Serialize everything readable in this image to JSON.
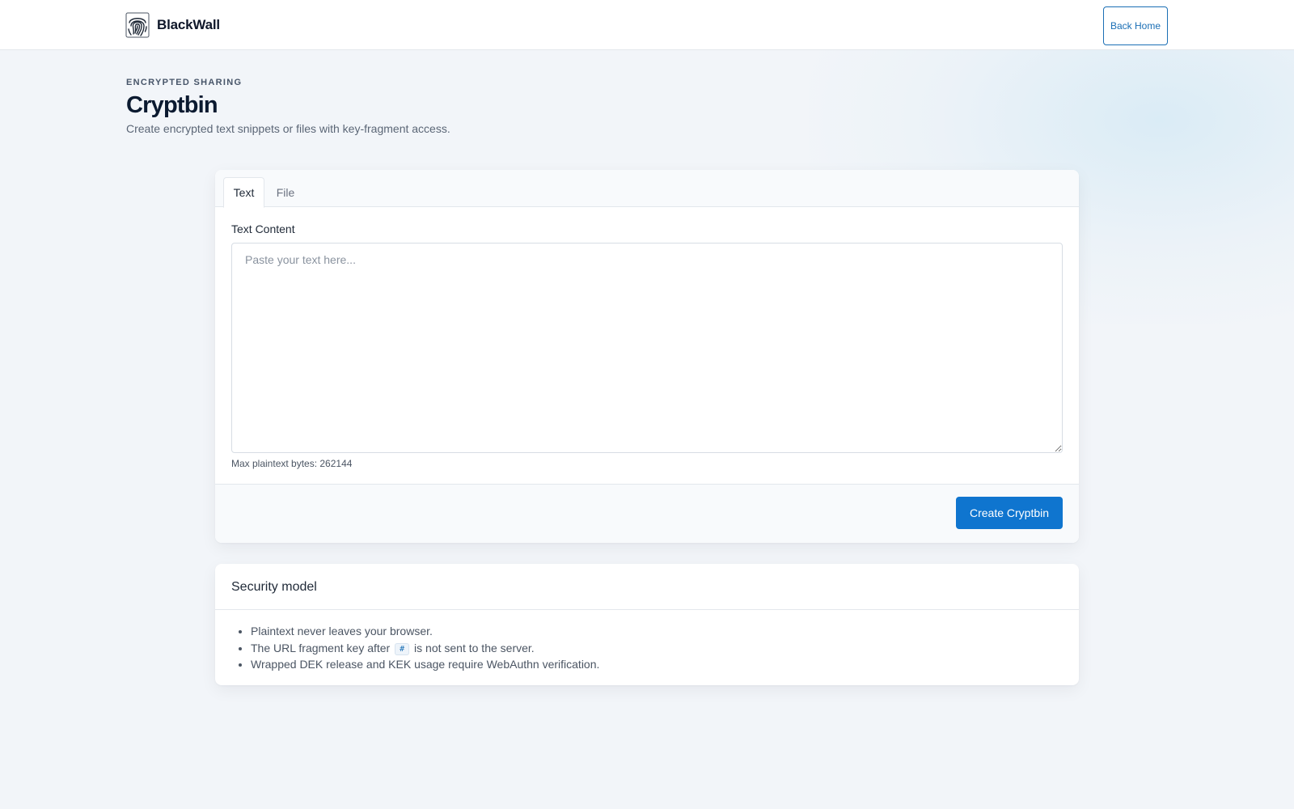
{
  "header": {
    "brand_name": "BlackWall",
    "back_home_label": "Back Home"
  },
  "hero": {
    "eyebrow": "ENCRYPTED SHARING",
    "title": "Cryptbin",
    "subtitle": "Create encrypted text snippets or files with key-fragment access."
  },
  "form": {
    "tabs": [
      {
        "label": "Text",
        "active": true
      },
      {
        "label": "File",
        "active": false
      }
    ],
    "field_label": "Text Content",
    "textarea_placeholder": "Paste your text here...",
    "textarea_value": "",
    "hint": "Max plaintext bytes: 262144",
    "submit_label": "Create Cryptbin"
  },
  "security": {
    "title": "Security model",
    "items": [
      "Plaintext never leaves your browser.",
      {
        "before": "The URL fragment key after",
        "code": "#",
        "after": "is not sent to the server."
      },
      "Wrapped DEK release and KEK usage require WebAuthn verification."
    ]
  },
  "colors": {
    "accent": "#0f75cf",
    "page_background": "#f2f5f9",
    "title": "#0b1a30"
  },
  "icons": {
    "brand": "fingerprint-icon"
  }
}
